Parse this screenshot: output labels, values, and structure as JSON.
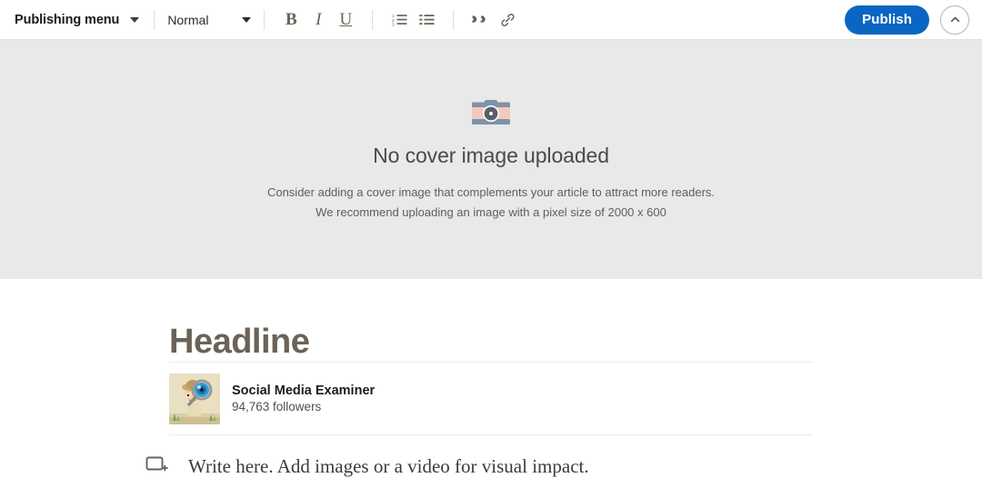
{
  "toolbar": {
    "publishing_menu_label": "Publishing menu",
    "publishing_menu_icon": "chevron-down-icon",
    "text_style_value": "Normal",
    "text_style_icon": "chevron-down-icon",
    "bold_label": "B",
    "italic_label": "I",
    "underline_label": "U",
    "ordered_list_icon": "numbered-list-icon",
    "bulleted_list_icon": "bulleted-list-icon",
    "quote_icon": "quote-icon",
    "link_icon": "link-icon",
    "publish_label": "Publish",
    "collapse_icon": "chevron-up-icon",
    "accent_color": "#0a66c2",
    "icon_color": "#6b6257"
  },
  "cover": {
    "icon": "camera-icon",
    "title": "No cover image uploaded",
    "line1": "Consider adding a cover image that complements your article to attract more readers.",
    "line2": "We recommend uploading an image with a pixel size of 2000 x 600",
    "background_color": "#e9e9e9",
    "camera_body_color": "#f4c9bd",
    "camera_frame_color": "#7e93a8",
    "camera_lens_color": "#55606b"
  },
  "article": {
    "headline_placeholder": "Headline",
    "headline_color": "#6b6257",
    "author": {
      "avatar_icon": "social-media-examiner-avatar",
      "name": "Social Media Examiner",
      "followers": "94,763 followers"
    },
    "body_add_icon": "add-media-icon",
    "body_placeholder": "Write here. Add images or a video for visual impact."
  }
}
